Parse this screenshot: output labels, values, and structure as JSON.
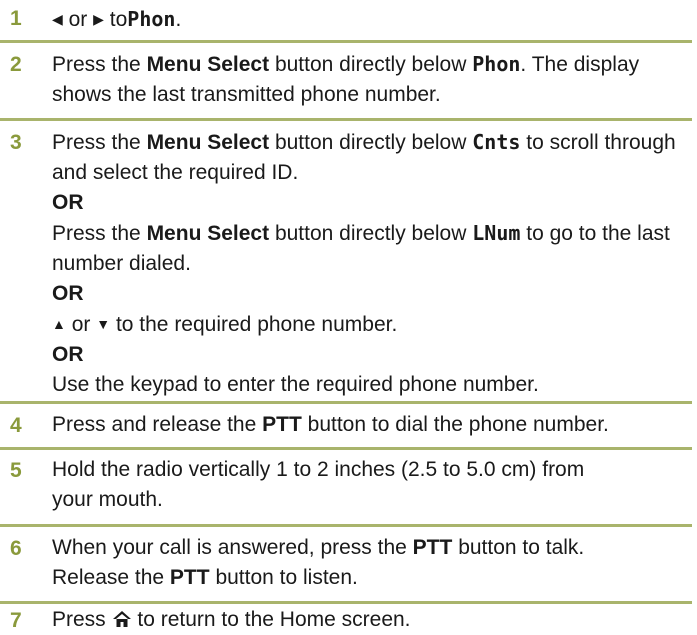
{
  "steps": [
    {
      "num": "1",
      "left_glyph": "◀",
      "or": "or",
      "right_glyph": "▶",
      "to": "to",
      "menu": "Phon",
      "end": "."
    },
    {
      "num": "2",
      "pre": "Press the",
      "button": "Menu Select",
      "post": "button directly below",
      "menu": "Phon",
      "period": ".",
      "tail": "The display shows the last transmitted phone number."
    },
    {
      "num": "3",
      "a_pre": "Press the",
      "a_button": "Menu Select",
      "a_post": "button directly below",
      "a_menu": "Cnts",
      "a_tail": "to scroll through and select the required ID.",
      "or1": "OR",
      "b_pre": "Press the",
      "b_button": "Menu Select",
      "b_post": "button directly below",
      "b_menu": "LNum",
      "b_tail": "to go to the last number dialed.",
      "or2": "OR",
      "c_up": "▲",
      "c_or": "or",
      "c_down": "▼",
      "c_tail": "to the required phone number.",
      "or3": "OR",
      "d_text": "Use the keypad to enter the required phone number."
    },
    {
      "num": "4",
      "pre": "Press and release the",
      "button": "PTT",
      "post": "button to dial the phone number."
    },
    {
      "num": "5",
      "line1": "Hold the radio vertically 1 to 2 inches (2.5 to 5.0 cm) from",
      "line2": "your mouth."
    },
    {
      "num": "6",
      "pre": "When your call is answered, press the",
      "button": "PTT",
      "post": "button to talk.",
      "pre2": "Release the",
      "button2": "PTT",
      "post2": "button to listen."
    },
    {
      "num": "7",
      "pre": "Press",
      "icon": "home-icon",
      "post": "to return to the Home screen."
    }
  ],
  "colors": {
    "number": "#8a9a3c",
    "rule": "#a9b46c",
    "text": "#1a1a1a"
  }
}
